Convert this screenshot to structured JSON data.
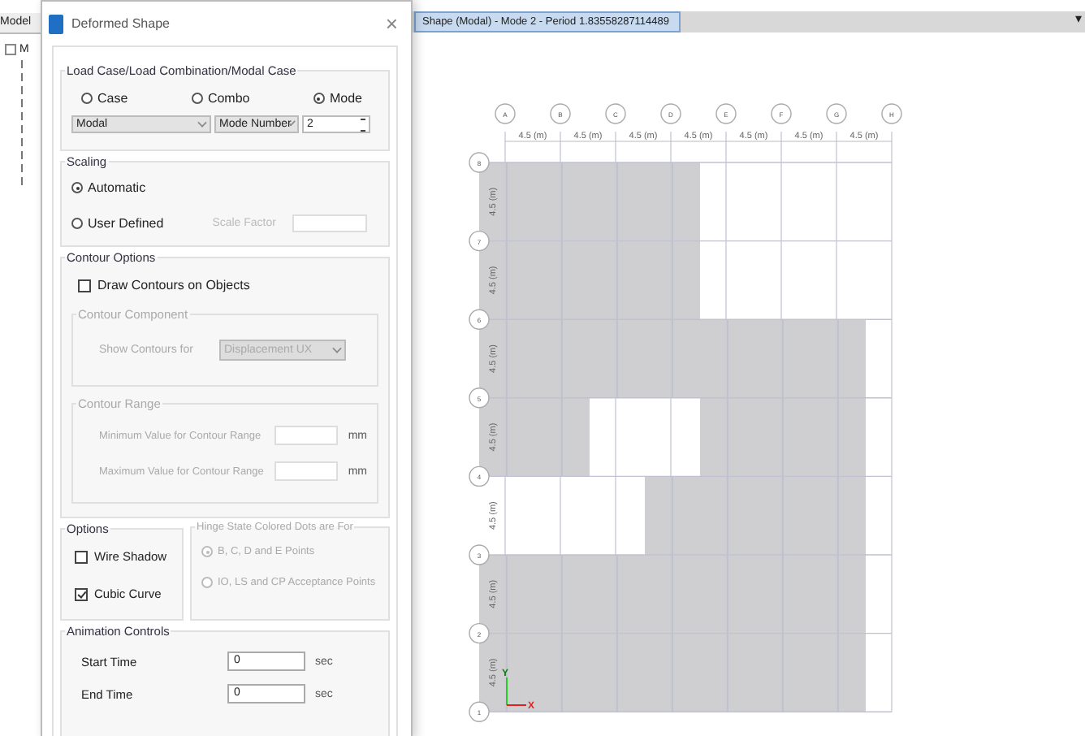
{
  "app": {
    "panel_tab": "Model",
    "tree_root": "M",
    "view_tab": {
      "title": "Shape (Modal) - Mode 2 - Period 1.83558287114489",
      "selected": true
    },
    "menu_arrow": "▾"
  },
  "dialog": {
    "title": "Deformed Shape",
    "close": "×",
    "load_case": {
      "legend": "Load Case/Load Combination/Modal Case",
      "options": [
        {
          "label": "Case",
          "selected": false
        },
        {
          "label": "Combo",
          "selected": false
        },
        {
          "label": "Mode",
          "selected": true
        }
      ],
      "case_select": "Modal",
      "mode_label": "Mode Number",
      "mode_value": "2"
    },
    "scaling": {
      "legend": "Scaling",
      "options": [
        {
          "label": "Automatic",
          "selected": true
        },
        {
          "label": "User Defined",
          "selected": false
        }
      ],
      "factor_label": "Scale Factor",
      "disabled_factor": true
    },
    "contour": {
      "legend": "Contour Options",
      "draw": {
        "label": "Draw Contours on Objects",
        "checked": false
      },
      "component": {
        "legend": "Contour Component",
        "label": "Show Contours for",
        "value": "Displacement UX",
        "disabled": true
      },
      "range": {
        "legend": "Contour Range",
        "disabled": true,
        "rows": [
          {
            "label": "Minimum Value for Contour Range",
            "unit": "mm"
          },
          {
            "label": "Maximum Value for Contour Range",
            "unit": "mm"
          }
        ]
      }
    },
    "options": {
      "legend": "Options",
      "items": [
        {
          "label": "Wire Shadow",
          "checked": false
        },
        {
          "label": "Cubic Curve",
          "checked": true
        }
      ]
    },
    "hinge": {
      "legend": "Hinge State Colored Dots are For",
      "disabled": true,
      "options": [
        {
          "label": "B, C, D and E Points",
          "selected": true
        },
        {
          "label": "IO, LS and CP Acceptance Points",
          "selected": false
        }
      ]
    },
    "animation": {
      "legend": "Animation Controls",
      "rows": [
        {
          "label": "Start Time",
          "value": "0",
          "unit": "sec"
        },
        {
          "label": "End Time",
          "value": "0",
          "unit": "sec"
        }
      ]
    }
  },
  "plan": {
    "columns": [
      "A",
      "B",
      "C",
      "D",
      "E",
      "F",
      "G",
      "H"
    ],
    "spacings": [
      "4.5 (m)",
      "4.5 (m)",
      "4.5 (m)",
      "4.5 (m)",
      "4.5 (m)",
      "4.5 (m)",
      "4.5 (m)"
    ],
    "rows": [
      "8",
      "7",
      "6",
      "5",
      "4",
      "3",
      "2",
      "1"
    ],
    "row_spacings": [
      "4.5 (m)",
      "4.5 (m)",
      "4.5 (m)",
      "4.5 (m)",
      "4.5 (m)",
      "4.5 (m)",
      "4.5 (m)"
    ],
    "bands": [
      {
        "shaded": [
          true,
          true,
          true,
          true,
          false,
          false,
          false
        ]
      },
      {
        "shaded": [
          true,
          true,
          true,
          true,
          false,
          false,
          false
        ]
      },
      {
        "shaded": [
          true,
          true,
          true,
          true,
          true,
          true,
          true
        ]
      },
      {
        "shaded": [
          true,
          true,
          false,
          false,
          true,
          true,
          true
        ]
      },
      {
        "shaded": [
          false,
          false,
          false,
          true,
          true,
          true,
          true
        ]
      },
      {
        "shaded": [
          true,
          true,
          true,
          true,
          true,
          true,
          true
        ]
      },
      {
        "shaded": [
          true,
          true,
          true,
          true,
          true,
          true,
          true
        ]
      }
    ],
    "axis_x": "X",
    "axis_y": "Y"
  }
}
